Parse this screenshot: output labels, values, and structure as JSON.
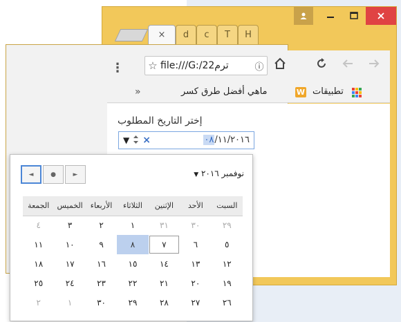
{
  "browser": {
    "tabs": [
      {
        "label": "×",
        "active": true
      },
      {
        "label": "d"
      },
      {
        "label": "c"
      },
      {
        "label": "T"
      },
      {
        "label": "H"
      }
    ],
    "url": "file:///G:/22ترم",
    "menu_glyph": "⋮",
    "bookmarks": {
      "overflow": "»",
      "item_1": "ماهي أفضل طرق كسر",
      "item_2": "تطبيقات",
      "item_1_icon": "W"
    }
  },
  "page": {
    "date_label": "إختر التاريخ المطلوب",
    "date_day_selected": "٠٨",
    "date_rest": "/١١/٢٠١٦"
  },
  "calendar": {
    "month_year": "نوفمبر ٢٠١٦",
    "weekdays": [
      "الجمعة",
      "الخميس",
      "الأربعاء",
      "الثلاثاء",
      "الإثنين",
      "الأحد",
      "السبت"
    ],
    "weeks": [
      [
        "٤",
        "٣",
        "٢",
        "١",
        "٣١",
        "٣٠",
        "٢٩"
      ],
      [
        "١١",
        "١٠",
        "٩",
        "٨",
        "٧",
        "٦",
        "٥"
      ],
      [
        "١٨",
        "١٧",
        "١٦",
        "١٥",
        "١٤",
        "١٣",
        "١٢"
      ],
      [
        "٢٥",
        "٢٤",
        "٢٣",
        "٢٢",
        "٢١",
        "٢٠",
        "١٩"
      ],
      [
        "٢",
        "١",
        "٣٠",
        "٢٩",
        "٢٨",
        "٢٧",
        "٢٦"
      ]
    ],
    "selected_day": "٨",
    "today_day": "٧"
  }
}
